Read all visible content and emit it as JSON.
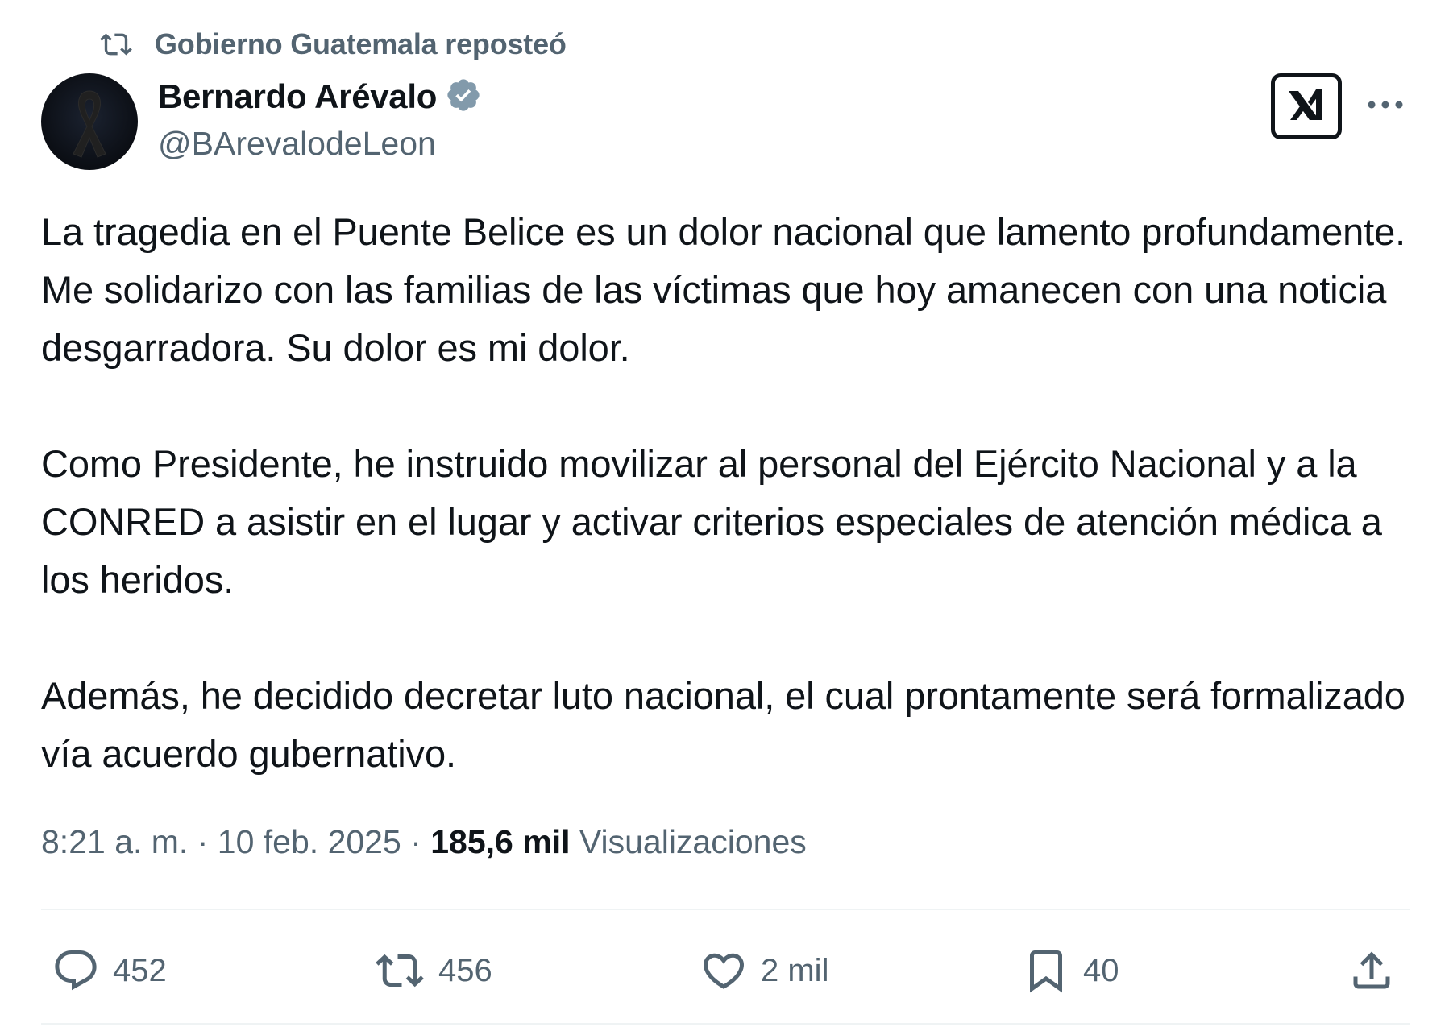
{
  "repost": {
    "icon": "repost-icon",
    "text": "Gobierno Guatemala reposteó"
  },
  "author": {
    "name": "Bernardo Arévalo",
    "handle": "@BArevalodeLeon",
    "verified_icon": "verified-badge-icon",
    "avatar_icon": "mourning-ribbon-icon"
  },
  "header_actions": {
    "grok_icon": "grok-icon",
    "more_icon": "more-options-icon"
  },
  "tweet": {
    "paragraphs": [
      "La tragedia en el Puente Belice es un dolor nacional que lamento profundamente. Me solidarizo con las familias de las víctimas que hoy amanecen con una noticia desgarradora. Su dolor es mi dolor.",
      "Como Presidente, he instruido movilizar al personal del Ejército Nacional y a la CONRED a asistir en el lugar y activar criterios especiales de atención médica a los heridos.",
      "Además, he decidido decretar luto nacional, el cual prontamente será formalizado vía acuerdo gubernativo."
    ]
  },
  "meta": {
    "time": "8:21 a. m.",
    "separator": "·",
    "date": "10 feb. 2025",
    "views_count": "185,6 mil",
    "views_label": "Visualizaciones"
  },
  "actions": {
    "reply": {
      "icon": "reply-icon",
      "count": "452"
    },
    "repost": {
      "icon": "repost-icon",
      "count": "456"
    },
    "like": {
      "icon": "like-icon",
      "count": "2 mil"
    },
    "bookmark": {
      "icon": "bookmark-icon",
      "count": "40"
    },
    "share": {
      "icon": "share-icon"
    }
  },
  "colors": {
    "text_primary": "#0f1419",
    "text_secondary": "#536471",
    "verified_badge": "#829aab",
    "divider": "#eff3f4"
  }
}
